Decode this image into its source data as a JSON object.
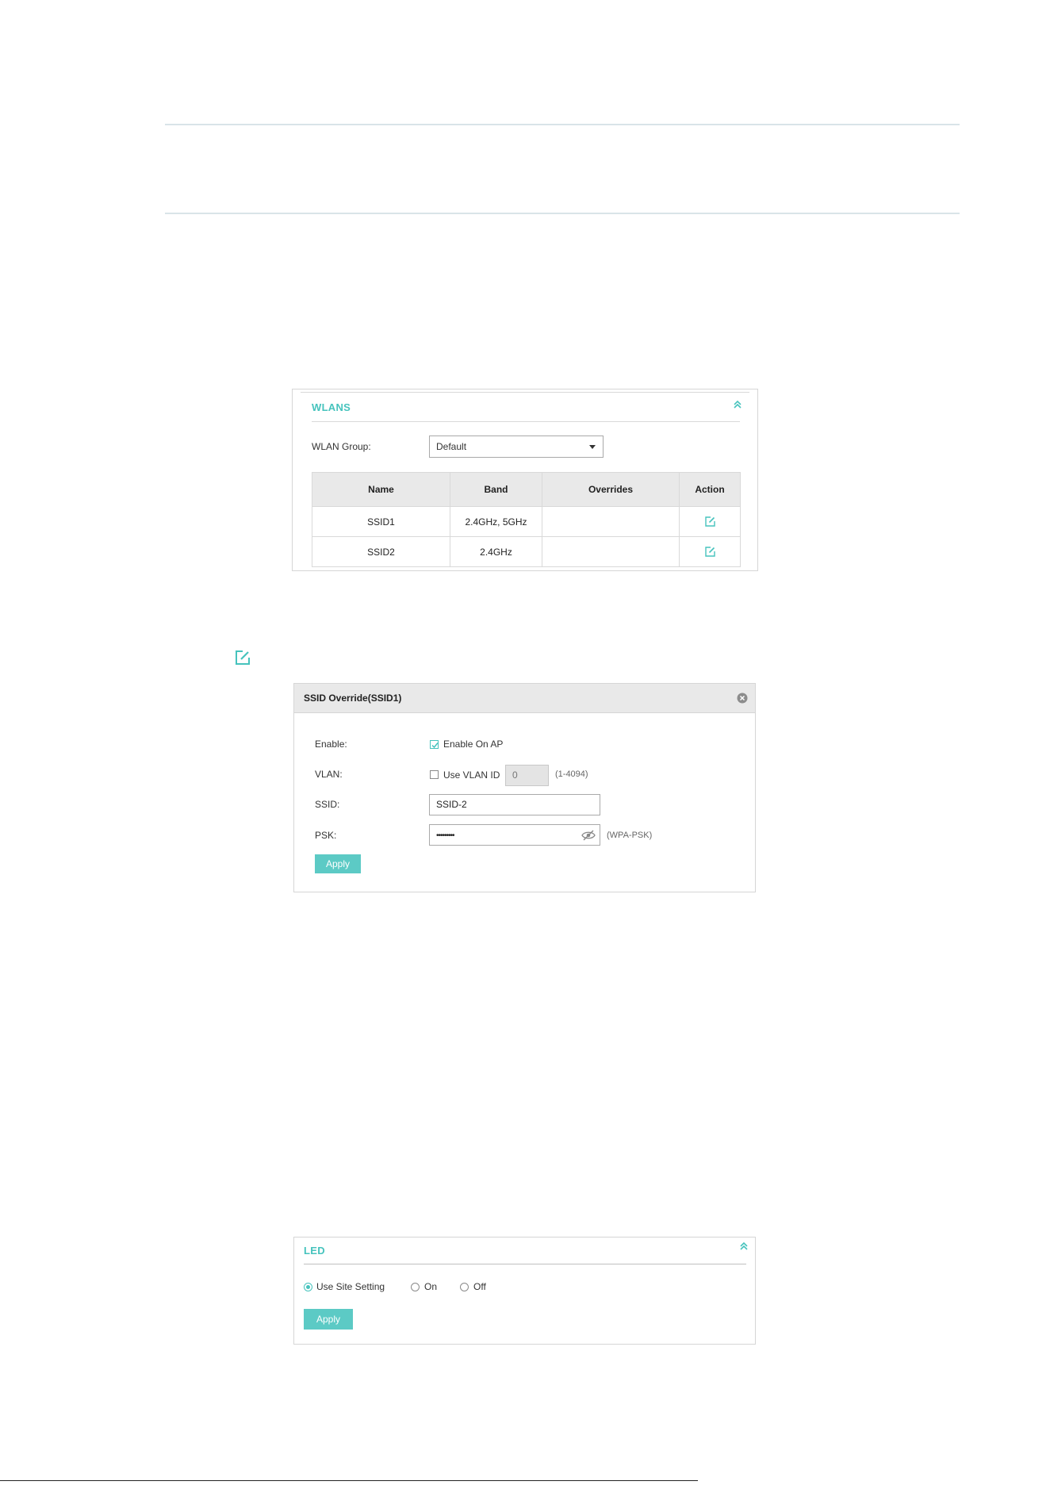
{
  "wlans_panel": {
    "title": "WLANS",
    "group_label": "WLAN Group:",
    "group_value": "Default",
    "table": {
      "headers": [
        "Name",
        "Band",
        "Overrides",
        "Action"
      ],
      "rows": [
        {
          "name": "SSID1",
          "band": "2.4GHz, 5GHz",
          "overrides": ""
        },
        {
          "name": "SSID2",
          "band": "2.4GHz",
          "overrides": ""
        }
      ]
    }
  },
  "ssid_override": {
    "title": "SSID Override(SSID1)",
    "enable_label": "Enable:",
    "enable_option": "Enable On AP",
    "enable_checked": true,
    "vlan_label": "VLAN:",
    "vlan_option": "Use VLAN ID",
    "vlan_checked": false,
    "vlan_value": "0",
    "vlan_hint": "(1-4094)",
    "ssid_label": "SSID:",
    "ssid_value": "SSID-2",
    "psk_label": "PSK:",
    "psk_value": "•••••••••",
    "psk_hint": "(WPA-PSK)",
    "apply_label": "Apply"
  },
  "led_panel": {
    "title": "LED",
    "options": [
      "Use Site Setting",
      "On",
      "Off"
    ],
    "selected": "Use Site Setting",
    "apply_label": "Apply"
  },
  "colors": {
    "accent": "#46c3bd",
    "button": "#5ccac5",
    "header_bg": "#e9e9e9"
  }
}
